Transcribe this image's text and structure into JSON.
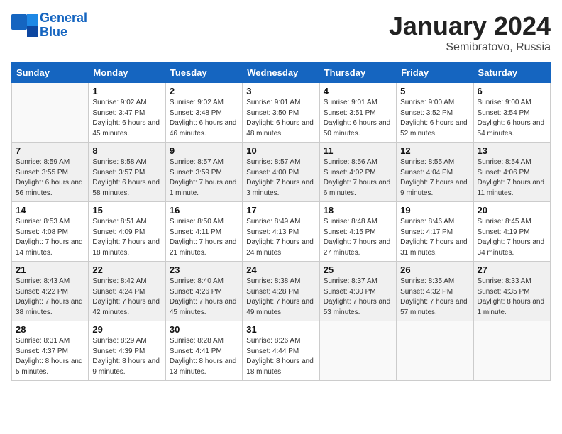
{
  "header": {
    "logo_general": "General",
    "logo_blue": "Blue",
    "month": "January 2024",
    "location": "Semibratovo, Russia"
  },
  "days_of_week": [
    "Sunday",
    "Monday",
    "Tuesday",
    "Wednesday",
    "Thursday",
    "Friday",
    "Saturday"
  ],
  "weeks": [
    [
      {
        "day": "",
        "sunrise": "",
        "sunset": "",
        "daylight": ""
      },
      {
        "day": "1",
        "sunrise": "9:02 AM",
        "sunset": "3:47 PM",
        "daylight": "6 hours and 45 minutes."
      },
      {
        "day": "2",
        "sunrise": "9:02 AM",
        "sunset": "3:48 PM",
        "daylight": "6 hours and 46 minutes."
      },
      {
        "day": "3",
        "sunrise": "9:01 AM",
        "sunset": "3:50 PM",
        "daylight": "6 hours and 48 minutes."
      },
      {
        "day": "4",
        "sunrise": "9:01 AM",
        "sunset": "3:51 PM",
        "daylight": "6 hours and 50 minutes."
      },
      {
        "day": "5",
        "sunrise": "9:00 AM",
        "sunset": "3:52 PM",
        "daylight": "6 hours and 52 minutes."
      },
      {
        "day": "6",
        "sunrise": "9:00 AM",
        "sunset": "3:54 PM",
        "daylight": "6 hours and 54 minutes."
      }
    ],
    [
      {
        "day": "7",
        "sunrise": "8:59 AM",
        "sunset": "3:55 PM",
        "daylight": "6 hours and 56 minutes."
      },
      {
        "day": "8",
        "sunrise": "8:58 AM",
        "sunset": "3:57 PM",
        "daylight": "6 hours and 58 minutes."
      },
      {
        "day": "9",
        "sunrise": "8:57 AM",
        "sunset": "3:59 PM",
        "daylight": "7 hours and 1 minute."
      },
      {
        "day": "10",
        "sunrise": "8:57 AM",
        "sunset": "4:00 PM",
        "daylight": "7 hours and 3 minutes."
      },
      {
        "day": "11",
        "sunrise": "8:56 AM",
        "sunset": "4:02 PM",
        "daylight": "7 hours and 6 minutes."
      },
      {
        "day": "12",
        "sunrise": "8:55 AM",
        "sunset": "4:04 PM",
        "daylight": "7 hours and 9 minutes."
      },
      {
        "day": "13",
        "sunrise": "8:54 AM",
        "sunset": "4:06 PM",
        "daylight": "7 hours and 11 minutes."
      }
    ],
    [
      {
        "day": "14",
        "sunrise": "8:53 AM",
        "sunset": "4:08 PM",
        "daylight": "7 hours and 14 minutes."
      },
      {
        "day": "15",
        "sunrise": "8:51 AM",
        "sunset": "4:09 PM",
        "daylight": "7 hours and 18 minutes."
      },
      {
        "day": "16",
        "sunrise": "8:50 AM",
        "sunset": "4:11 PM",
        "daylight": "7 hours and 21 minutes."
      },
      {
        "day": "17",
        "sunrise": "8:49 AM",
        "sunset": "4:13 PM",
        "daylight": "7 hours and 24 minutes."
      },
      {
        "day": "18",
        "sunrise": "8:48 AM",
        "sunset": "4:15 PM",
        "daylight": "7 hours and 27 minutes."
      },
      {
        "day": "19",
        "sunrise": "8:46 AM",
        "sunset": "4:17 PM",
        "daylight": "7 hours and 31 minutes."
      },
      {
        "day": "20",
        "sunrise": "8:45 AM",
        "sunset": "4:19 PM",
        "daylight": "7 hours and 34 minutes."
      }
    ],
    [
      {
        "day": "21",
        "sunrise": "8:43 AM",
        "sunset": "4:22 PM",
        "daylight": "7 hours and 38 minutes."
      },
      {
        "day": "22",
        "sunrise": "8:42 AM",
        "sunset": "4:24 PM",
        "daylight": "7 hours and 42 minutes."
      },
      {
        "day": "23",
        "sunrise": "8:40 AM",
        "sunset": "4:26 PM",
        "daylight": "7 hours and 45 minutes."
      },
      {
        "day": "24",
        "sunrise": "8:38 AM",
        "sunset": "4:28 PM",
        "daylight": "7 hours and 49 minutes."
      },
      {
        "day": "25",
        "sunrise": "8:37 AM",
        "sunset": "4:30 PM",
        "daylight": "7 hours and 53 minutes."
      },
      {
        "day": "26",
        "sunrise": "8:35 AM",
        "sunset": "4:32 PM",
        "daylight": "7 hours and 57 minutes."
      },
      {
        "day": "27",
        "sunrise": "8:33 AM",
        "sunset": "4:35 PM",
        "daylight": "8 hours and 1 minute."
      }
    ],
    [
      {
        "day": "28",
        "sunrise": "8:31 AM",
        "sunset": "4:37 PM",
        "daylight": "8 hours and 5 minutes."
      },
      {
        "day": "29",
        "sunrise": "8:29 AM",
        "sunset": "4:39 PM",
        "daylight": "8 hours and 9 minutes."
      },
      {
        "day": "30",
        "sunrise": "8:28 AM",
        "sunset": "4:41 PM",
        "daylight": "8 hours and 13 minutes."
      },
      {
        "day": "31",
        "sunrise": "8:26 AM",
        "sunset": "4:44 PM",
        "daylight": "8 hours and 18 minutes."
      },
      {
        "day": "",
        "sunrise": "",
        "sunset": "",
        "daylight": ""
      },
      {
        "day": "",
        "sunrise": "",
        "sunset": "",
        "daylight": ""
      },
      {
        "day": "",
        "sunrise": "",
        "sunset": "",
        "daylight": ""
      }
    ]
  ]
}
